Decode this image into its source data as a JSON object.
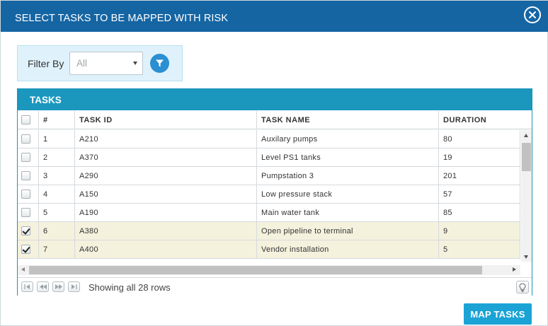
{
  "dialog": {
    "title": "SELECT TASKS TO BE MAPPED WITH RISK",
    "close_icon": "close-circle-icon"
  },
  "filter": {
    "label": "Filter By",
    "value": "All",
    "options": [
      "All"
    ],
    "button_icon": "funnel-filter-icon"
  },
  "grid": {
    "title": "TASKS",
    "columns": [
      "#",
      "TASK ID",
      "TASK NAME",
      "DURATION"
    ],
    "rows": [
      {
        "num": "1",
        "task_id": "A210",
        "task_name": "Auxilary pumps",
        "duration": "80",
        "checked": false
      },
      {
        "num": "2",
        "task_id": "A370",
        "task_name": "Level PS1 tanks",
        "duration": "19",
        "checked": false
      },
      {
        "num": "3",
        "task_id": "A290",
        "task_name": "Pumpstation 3",
        "duration": "201",
        "checked": false
      },
      {
        "num": "4",
        "task_id": "A150",
        "task_name": "Low pressure stack",
        "duration": "57",
        "checked": false
      },
      {
        "num": "5",
        "task_id": "A190",
        "task_name": "Main water tank",
        "duration": "85",
        "checked": false
      },
      {
        "num": "6",
        "task_id": "A380",
        "task_name": "Open pipeline to terminal",
        "duration": "9",
        "checked": true
      },
      {
        "num": "7",
        "task_id": "A400",
        "task_name": "Vendor installation",
        "duration": "5",
        "checked": true
      }
    ],
    "pager_info": "Showing all 28 rows"
  },
  "actions": {
    "map_label": "MAP TASKS"
  },
  "colors": {
    "titlebar": "#1565a3",
    "grid_header": "#1b97be",
    "checked_row": "#f4f1dd",
    "primary_button": "#1ba3d6",
    "filter_button": "#2a8fd3"
  }
}
